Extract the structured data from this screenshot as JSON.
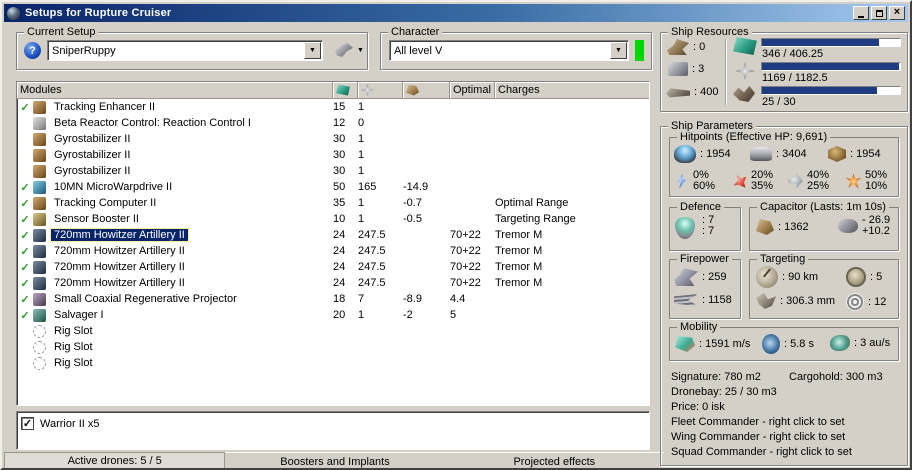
{
  "window": {
    "title": "Setups for Rupture Cruiser"
  },
  "setup": {
    "group_label": "Current Setup",
    "value": "SniperRuppy"
  },
  "character": {
    "group_label": "Character",
    "value": "All level V"
  },
  "modules": {
    "header": {
      "name": "Modules",
      "optimal": "Optimal",
      "charges": "Charges"
    },
    "rows": [
      {
        "fitted": true,
        "selected": false,
        "icon": "tan",
        "name": "Tracking Enhancer II",
        "cpu": "15",
        "pg": "1",
        "cap": "",
        "optimal": "",
        "charge": ""
      },
      {
        "fitted": false,
        "selected": false,
        "icon": "gray",
        "name": "Beta Reactor Control: Reaction Control I",
        "cpu": "12",
        "pg": "0",
        "cap": "",
        "optimal": "",
        "charge": ""
      },
      {
        "fitted": false,
        "selected": false,
        "icon": "tan",
        "name": "Gyrostabilizer II",
        "cpu": "30",
        "pg": "1",
        "cap": "",
        "optimal": "",
        "charge": ""
      },
      {
        "fitted": false,
        "selected": false,
        "icon": "tan",
        "name": "Gyrostabilizer II",
        "cpu": "30",
        "pg": "1",
        "cap": "",
        "optimal": "",
        "charge": ""
      },
      {
        "fitted": false,
        "selected": false,
        "icon": "tan",
        "name": "Gyrostabilizer II",
        "cpu": "30",
        "pg": "1",
        "cap": "",
        "optimal": "",
        "charge": ""
      },
      {
        "fitted": true,
        "selected": false,
        "icon": "blue",
        "name": "10MN MicroWarpdrive II",
        "cpu": "50",
        "pg": "165",
        "cap": "-14.9",
        "optimal": "",
        "charge": ""
      },
      {
        "fitted": true,
        "selected": false,
        "icon": "tan",
        "name": "Tracking Computer II",
        "cpu": "35",
        "pg": "1",
        "cap": "-0.7",
        "optimal": "",
        "charge": "Optimal Range"
      },
      {
        "fitted": true,
        "selected": false,
        "icon": "gold",
        "name": "Sensor Booster II",
        "cpu": "10",
        "pg": "1",
        "cap": "-0.5",
        "optimal": "",
        "charge": "Targeting Range"
      },
      {
        "fitted": true,
        "selected": true,
        "icon": "dark",
        "name": "720mm Howitzer Artillery II",
        "cpu": "24",
        "pg": "247.5",
        "cap": "",
        "optimal": "70+22",
        "charge": "Tremor M"
      },
      {
        "fitted": true,
        "selected": false,
        "icon": "dark",
        "name": "720mm Howitzer Artillery II",
        "cpu": "24",
        "pg": "247.5",
        "cap": "",
        "optimal": "70+22",
        "charge": "Tremor M"
      },
      {
        "fitted": true,
        "selected": false,
        "icon": "dark",
        "name": "720mm Howitzer Artillery II",
        "cpu": "24",
        "pg": "247.5",
        "cap": "",
        "optimal": "70+22",
        "charge": "Tremor M"
      },
      {
        "fitted": true,
        "selected": false,
        "icon": "dark",
        "name": "720mm Howitzer Artillery II",
        "cpu": "24",
        "pg": "247.5",
        "cap": "",
        "optimal": "70+22",
        "charge": "Tremor M"
      },
      {
        "fitted": true,
        "selected": false,
        "icon": "purple",
        "name": "Small Coaxial Regenerative Projector",
        "cpu": "18",
        "pg": "7",
        "cap": "-8.9",
        "optimal": "4.4",
        "charge": ""
      },
      {
        "fitted": true,
        "selected": false,
        "icon": "teal",
        "name": "Salvager I",
        "cpu": "20",
        "pg": "1",
        "cap": "-2",
        "optimal": "5",
        "charge": ""
      },
      {
        "fitted": false,
        "selected": false,
        "icon": "rig",
        "name": "Rig Slot",
        "cpu": "",
        "pg": "",
        "cap": "",
        "optimal": "",
        "charge": ""
      },
      {
        "fitted": false,
        "selected": false,
        "icon": "rig",
        "name": "Rig Slot",
        "cpu": "",
        "pg": "",
        "cap": "",
        "optimal": "",
        "charge": ""
      },
      {
        "fitted": false,
        "selected": false,
        "icon": "rig",
        "name": "Rig Slot",
        "cpu": "",
        "pg": "",
        "cap": "",
        "optimal": "",
        "charge": ""
      }
    ]
  },
  "drones": {
    "items": [
      {
        "checked": true,
        "label": "Warrior II x5"
      }
    ]
  },
  "bottom_bar": {
    "active_drones": "Active drones: 5 / 5",
    "boosters": "Boosters and Implants",
    "projected": "Projected effects"
  },
  "resources": {
    "group_label": "Ship Resources",
    "turrets": ": 0",
    "launchers": ": 3",
    "calibration": ": 400",
    "cpu": {
      "text": "346 / 406.25",
      "pct": 85
    },
    "powergrid": {
      "text": "1169 / 1182.5",
      "pct": 99
    },
    "dronebay": {
      "text": "25 / 30",
      "pct": 83
    }
  },
  "parameters": {
    "group_label": "Ship Parameters",
    "hitpoints": {
      "group_label": "Hitpoints (Effective HP: 9,691)",
      "shield": ": 1954",
      "armor": ": 3404",
      "structure": ": 1954",
      "resists": [
        {
          "name": "em",
          "top": "0%",
          "bottom": "60%"
        },
        {
          "name": "thermal",
          "top": "20%",
          "bottom": "35%"
        },
        {
          "name": "kinetic",
          "top": "40%",
          "bottom": "25%"
        },
        {
          "name": "explosive",
          "top": "50%",
          "bottom": "10%"
        }
      ]
    },
    "defence": {
      "group_label": "Defence",
      "line1": ": 7",
      "line2": ": 7"
    },
    "capacitor": {
      "group_label": "Capacitor (Lasts: 1m 10s)",
      "amount": ": 1362",
      "drain": "- 26.9",
      "recharge": "+10.2"
    },
    "firepower": {
      "group_label": "Firepower",
      "dps": ": 259",
      "volley": ": 1158"
    },
    "targeting": {
      "group_label": "Targeting",
      "range": ": 90 km",
      "max_targets": ": 5",
      "scan_res": ": 306.3 mm",
      "sensor_strength": ": 12"
    },
    "mobility": {
      "group_label": "Mobility",
      "speed": ": 1591 m/s",
      "align": ": 5.8 s",
      "warp": ": 3 au/s"
    },
    "info": {
      "signature": "Signature: 780 m2",
      "cargohold": "Cargohold: 300 m3",
      "dronebay": "Dronebay: 25 / 30 m3",
      "price": "Price: 0 isk",
      "fleet": "Fleet Commander - right click to set",
      "wing": "Wing Commander - right click to set",
      "squad": "Squad Commander - right click to set"
    }
  },
  "colors": {
    "title_gradient_start": "#0a246a",
    "title_gradient_end": "#a6caf0",
    "selection": "#0a246a",
    "bar_fill": "#1e3c82",
    "character_bar_green": "#00d800",
    "check_green": "#2e9e2e"
  }
}
